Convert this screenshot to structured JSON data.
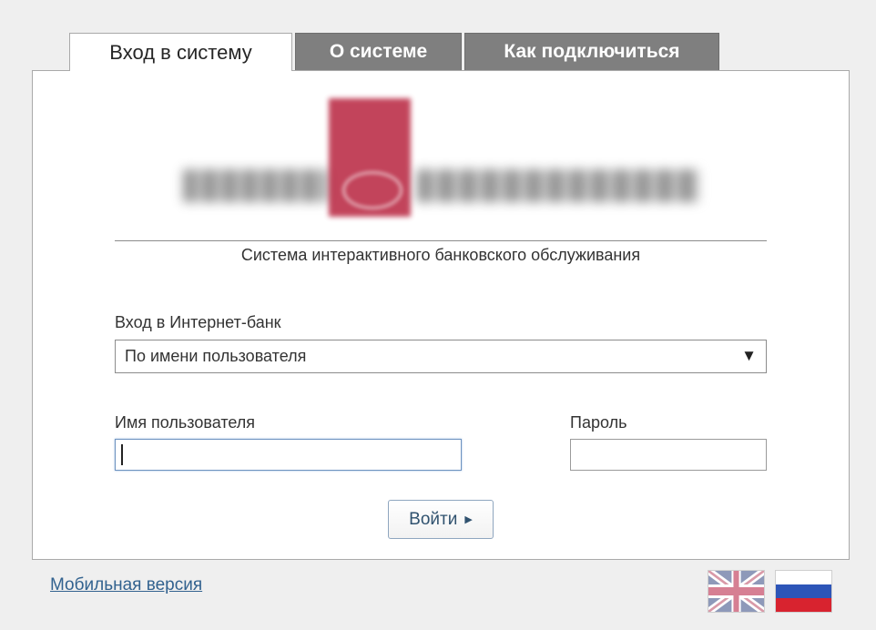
{
  "tabs": [
    {
      "label": "Вход в систему",
      "active": true
    },
    {
      "label": "О системе",
      "active": false
    },
    {
      "label": "Как подключиться",
      "active": false
    }
  ],
  "subtitle": "Система интерактивного банковского обслуживания",
  "login_method": {
    "label": "Вход в Интернет-банк",
    "selected": "По имени пользователя",
    "arrow": "▼"
  },
  "username": {
    "label": "Имя пользователя",
    "value": ""
  },
  "password": {
    "label": "Пароль",
    "value": ""
  },
  "submit": {
    "label": "Войти",
    "arrow": "▶"
  },
  "mobile_link": "Мобильная версия",
  "languages": [
    {
      "icon": "uk-flag-icon",
      "lang": "en"
    },
    {
      "icon": "russia-flag-icon",
      "lang": "ru"
    }
  ],
  "colors": {
    "background": "#efefef",
    "tab_inactive": "#7f7f7f",
    "logo_accent": "#b8243f",
    "link": "#32628f",
    "button_text": "#30526f"
  }
}
